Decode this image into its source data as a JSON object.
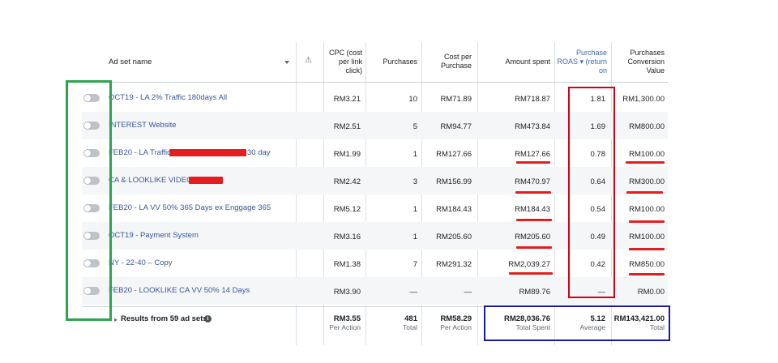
{
  "header": {
    "ad_set_name": "Ad set name",
    "cpc": "CPC (cost per link click)",
    "purchases": "Purchases",
    "cost_per_purchase": "Cost per Purchase",
    "amount_spent": "Amount spent",
    "roas": "Purchase ROAS ▾ (return on",
    "conversion_value": "Purchases Conversion Value",
    "sort_icon": "caret-down-icon",
    "warning_icon": "warning-icon"
  },
  "rows": [
    {
      "name": "OCT19 - LA 2% Traffic 180days All",
      "cpc": "RM3.21",
      "purchases": "10",
      "cost_per": "RM71.89",
      "spent": "RM718.87",
      "roas": "1.81",
      "value": "RM1,300.00",
      "toggle_on": false
    },
    {
      "name": "INTEREST Website",
      "cpc": "RM2.51",
      "purchases": "5",
      "cost_per": "RM94.77",
      "spent": "RM473.84",
      "roas": "1.69",
      "value": "RM800.00",
      "toggle_on": false
    },
    {
      "name": "FEB20 - LA Traffic",
      "name_suffix": "30 day",
      "cpc": "RM1.99",
      "purchases": "1",
      "cost_per": "RM127.66",
      "spent": "RM127.66",
      "roas": "0.78",
      "value": "RM100.00",
      "toggle_on": false
    },
    {
      "name": "CA & LOOKLIKE VIDEO",
      "cpc": "RM2.42",
      "purchases": "3",
      "cost_per": "RM156.99",
      "spent": "RM470.97",
      "roas": "0.64",
      "value": "RM300.00",
      "toggle_on": false
    },
    {
      "name": "FEB20 - LA VV 50% 365 Days ex Enggage 365",
      "cpc": "RM5.12",
      "purchases": "1",
      "cost_per": "RM184.43",
      "spent": "RM184.43",
      "roas": "0.54",
      "value": "RM100.00",
      "toggle_on": false
    },
    {
      "name": "OCT19 - Payment System",
      "cpc": "RM3.16",
      "purchases": "1",
      "cost_per": "RM205.60",
      "spent": "RM205.60",
      "roas": "0.49",
      "value": "RM100.00",
      "toggle_on": false
    },
    {
      "name": "NY - 22-40 – Copy",
      "cpc": "RM1.38",
      "purchases": "7",
      "cost_per": "RM291.32",
      "spent": "RM2,039.27",
      "roas": "0.42",
      "value": "RM850.00",
      "toggle_on": false
    },
    {
      "name": "FEB20 - LOOKLIKE CA VV 50% 14 Days",
      "cpc": "RM3.90",
      "purchases": "—",
      "cost_per": "—",
      "spent": "RM89.76",
      "roas": "—",
      "value": "RM0.00",
      "toggle_on": false
    }
  ],
  "footer": {
    "results_label": "Results from 59 ad sets",
    "info_icon": "info-icon",
    "cpc": "RM3.55",
    "cpc_sub": "Per Action",
    "purchases": "481",
    "purchases_sub": "Total",
    "cost_per": "RM58.29",
    "cost_per_sub": "Per Action",
    "spent": "RM28,036.76",
    "spent_sub": "Total Spent",
    "roas": "5.12",
    "roas_sub": "Average",
    "value": "RM143,421.00",
    "value_sub": "Total"
  },
  "annotations": {
    "toggle_box_color": "#2ea44f",
    "roas_box_color": "#d0021b",
    "totals_box_color": "#1a1aa8",
    "underline_color": "#e41e1e"
  }
}
